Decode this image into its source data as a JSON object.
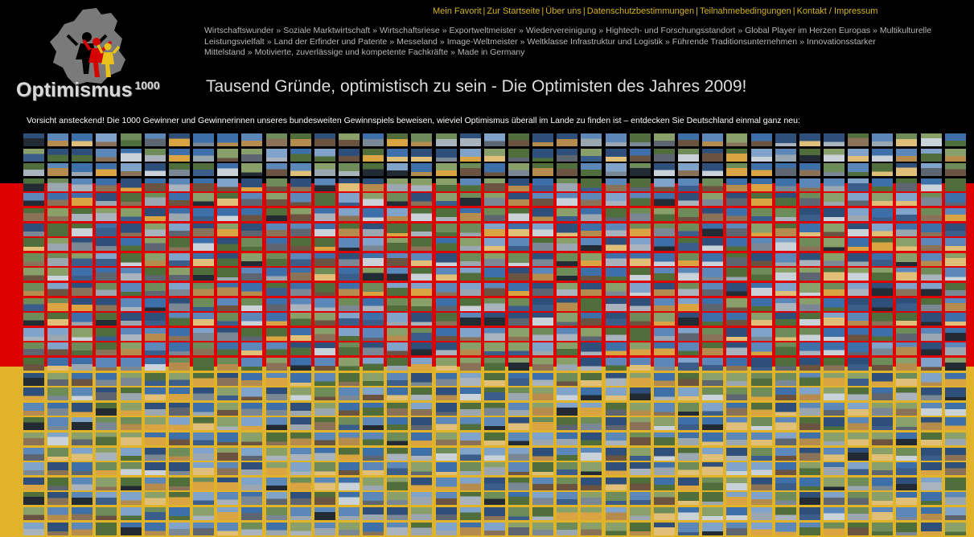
{
  "colors": {
    "black_band": "#000000",
    "red_band": "#dd0000",
    "gold_band": "#e0b328",
    "nav_text": "#d6b21a"
  },
  "topnav": {
    "links": [
      {
        "label": "Mein Favorit"
      },
      {
        "label": "Zur Startseite"
      },
      {
        "label": "Über uns"
      },
      {
        "label": "Datenschutzbestimmungen"
      },
      {
        "label": "Teilnahmebedingungen"
      },
      {
        "label": "Kontakt / Impressum"
      }
    ],
    "separator": "|"
  },
  "logo": {
    "text": "Optimismus",
    "superscript": "1000"
  },
  "keywords": {
    "separator": "»",
    "items": [
      "Wirtschaftswunder",
      "Soziale Marktwirtschaft",
      "Wirtschaftsriese",
      "Exportweltmeister",
      "Wiedervereinigung",
      "Hightech- und Forschungsstandort",
      "Global Player im Herzen Europas",
      "Multikulturelle Leistungsvielfalt",
      "Land der Erfinder und Patente",
      "Messeland",
      "Image-Weltmeister",
      "Weltklasse Infrastruktur und Logistik",
      "Führende Traditionsunternehmen",
      "Innovationsstarker Mittelstand",
      "Motivierte, zuverlässige und kompetente Fachkräfte",
      "Made in Germany"
    ]
  },
  "headline": "Tausend Gründe, optimistisch zu sein - Die Optimisten des Jahres 2009!",
  "intro": "Vorsicht ansteckend! Die 1000 Gewinner und Gewinnerinnen unseres bundesweiten Gewinnspiels beweisen, wieviel Optimismus überall im Lande zu finden ist – entdecken Sie Deutschland einmal ganz neu:",
  "photo_grid": {
    "columns": 39,
    "rows": 27,
    "palette": [
      "#3d6fa8",
      "#5b88b8",
      "#7fa3c9",
      "#2d4f7a",
      "#6e8c5a",
      "#8aa06a",
      "#4f6e3c",
      "#a8b3bd",
      "#c9d2d9",
      "#8a7258",
      "#6a5340",
      "#b58c4e",
      "#d9a441",
      "#222a33",
      "#5d6670",
      "#9aa6b0",
      "#3b5d8a",
      "#e0c078",
      "#7a8896",
      "#486a92"
    ]
  }
}
